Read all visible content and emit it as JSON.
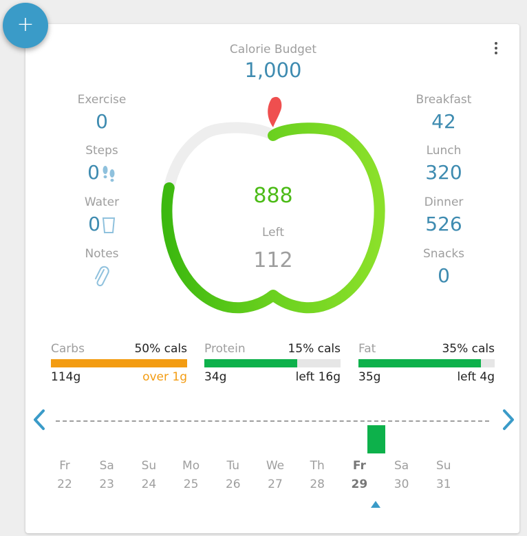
{
  "fab": {
    "label": "+"
  },
  "budget": {
    "label": "Calorie Budget",
    "value": "1,000"
  },
  "left_stats": [
    {
      "label": "Exercise",
      "value": "0",
      "icon": ""
    },
    {
      "label": "Steps",
      "value": "0",
      "icon": "footsteps-icon"
    },
    {
      "label": "Water",
      "value": "0",
      "icon": "glass-icon"
    },
    {
      "label": "Notes",
      "value": "",
      "icon": "paperclip-icon"
    }
  ],
  "right_stats": [
    {
      "label": "Breakfast",
      "value": "42"
    },
    {
      "label": "Lunch",
      "value": "320"
    },
    {
      "label": "Dinner",
      "value": "526"
    },
    {
      "label": "Snacks",
      "value": "0"
    }
  ],
  "apple": {
    "consumed": "888",
    "left_label": "Left",
    "left_value": "112",
    "progress": 0.888
  },
  "macros": [
    {
      "name": "Carbs",
      "pct": "50% cals",
      "grams": "114g",
      "status": "over 1g",
      "status_color": "#f39c12",
      "fill": 1.0,
      "color": "#f39c12"
    },
    {
      "name": "Protein",
      "pct": "15% cals",
      "grams": "34g",
      "status": "left 16g",
      "status_color": "#222222",
      "fill": 0.68,
      "color": "#0db14b"
    },
    {
      "name": "Fat",
      "pct": "35% cals",
      "grams": "35g",
      "status": "left 4g",
      "status_color": "#222222",
      "fill": 0.9,
      "color": "#0db14b"
    }
  ],
  "days": [
    {
      "name": "Fr",
      "date": "22"
    },
    {
      "name": "Sa",
      "date": "23"
    },
    {
      "name": "Su",
      "date": "24"
    },
    {
      "name": "Mo",
      "date": "25"
    },
    {
      "name": "Tu",
      "date": "26"
    },
    {
      "name": "We",
      "date": "27"
    },
    {
      "name": "Th",
      "date": "28"
    },
    {
      "name": "Fr",
      "date": "29",
      "selected": true
    },
    {
      "name": "Sa",
      "date": "30"
    },
    {
      "name": "Su",
      "date": "31"
    }
  ],
  "colors": {
    "accent": "#3a9bc8",
    "value": "#3e8bb0",
    "green": "#4cbb17",
    "green_light": "#8be02a",
    "stem": "#ef4f4f",
    "track": "#eeeeee"
  }
}
